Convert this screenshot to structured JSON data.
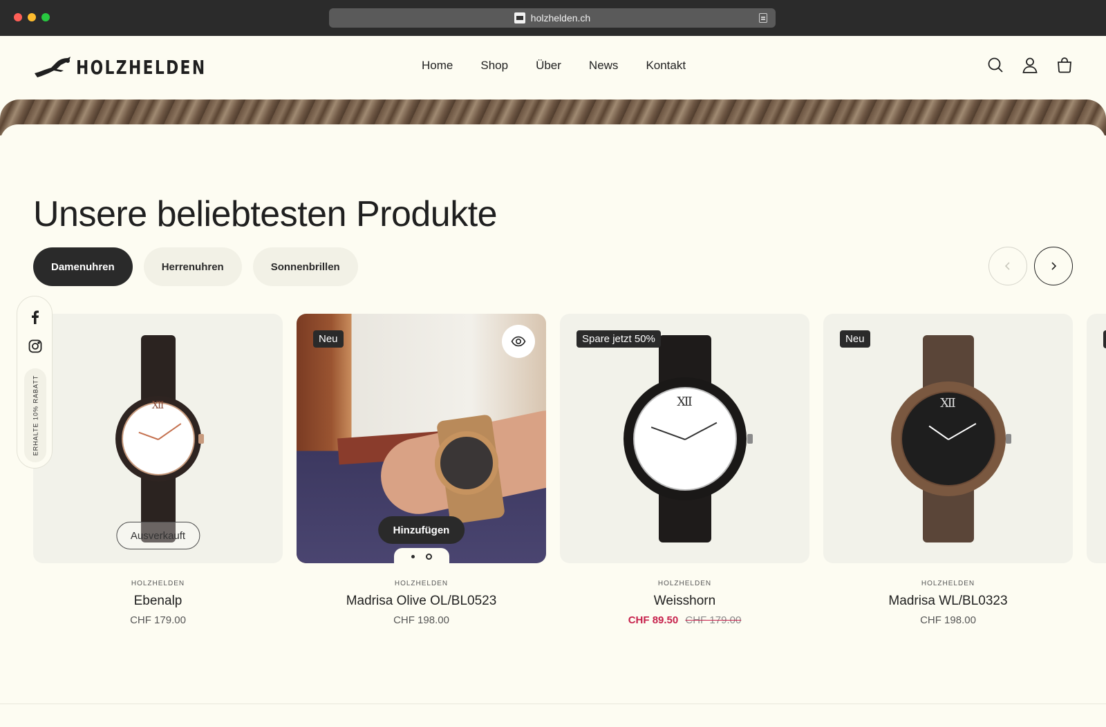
{
  "browser": {
    "url": "holzhelden.ch"
  },
  "header": {
    "logo_text": "HOLZHELDEN",
    "nav": [
      "Home",
      "Shop",
      "Über",
      "News",
      "Kontakt"
    ]
  },
  "section": {
    "title": "Unsere beliebtesten Produkte",
    "tabs": [
      {
        "label": "Damenuhren",
        "active": true
      },
      {
        "label": "Herrenuhren",
        "active": false
      },
      {
        "label": "Sonnenbrillen",
        "active": false
      }
    ]
  },
  "sidebar": {
    "discount_label": "ERHALTE 10% RABATT"
  },
  "products": [
    {
      "brand": "HOLZHELDEN",
      "name": "Ebenalp",
      "price": "CHF 179.00",
      "overlay": "Ausverkauft"
    },
    {
      "brand": "HOLZHELDEN",
      "name": "Madrisa Olive OL/BL0523",
      "price": "CHF 198.00",
      "badge": "Neu",
      "action": "Hinzufügen"
    },
    {
      "brand": "HOLZHELDEN",
      "name": "Weisshorn",
      "sale_price": "CHF 89.50",
      "old_price": "CHF 179.00",
      "badge": "Spare jetzt 50%"
    },
    {
      "brand": "HOLZHELDEN",
      "name": "Madrisa WL/BL0323",
      "price": "CHF 198.00",
      "badge": "Neu"
    }
  ],
  "colors": {
    "background": "#fdfcf2",
    "dark": "#2a2a2a",
    "sale": "#c6204b"
  }
}
